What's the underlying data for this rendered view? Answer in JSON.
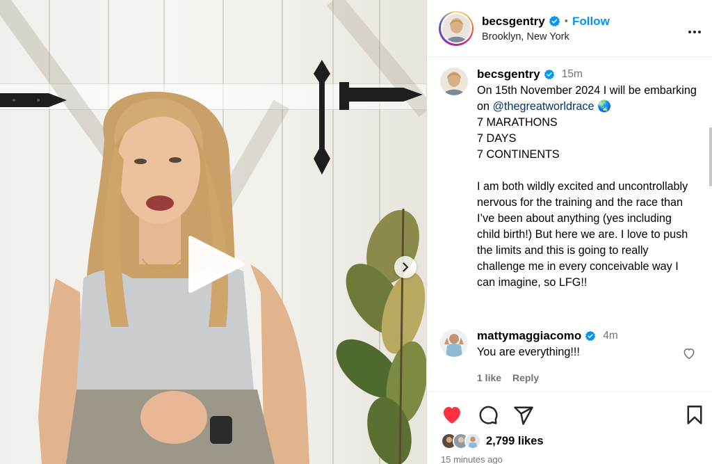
{
  "post": {
    "author": "becsgentry",
    "location": "Brooklyn, New York",
    "follow_label": "Follow",
    "separator": "•"
  },
  "caption": {
    "author": "becsgentry",
    "time": "15m",
    "line1": "On 15th November 2024 I will be embarking on ",
    "mention": "@thegreatworldrace",
    "emoji": "🌏",
    "line2": "7 MARATHONS",
    "line3": "7 DAYS",
    "line4": "7 CONTINENTS",
    "paragraph": "I am both wildly excited and uncontrollably nervous for the training and the race than I’ve been about anything (yes including child birth!) But here we are. I love to push the limits and this is going to really challenge me in every conceivable way I can imagine, so LFG!!"
  },
  "comment": {
    "author": "mattymaggiacomo",
    "time": "4m",
    "text": "You are everything!!!",
    "likes": "1 like",
    "reply_label": "Reply"
  },
  "footer": {
    "likes": "2,799 likes",
    "posted": "15 minutes ago"
  },
  "icons": {
    "like": "heart-filled-icon",
    "comment": "comment-bubble-icon",
    "share": "paper-plane-icon",
    "save": "bookmark-icon",
    "more": "more-horizontal-icon",
    "verified": "verified-badge-icon",
    "play": "play-icon",
    "next": "chevron-right-icon"
  },
  "colors": {
    "accent": "#0095f6",
    "like": "#ff3040",
    "verified": "#0095f6",
    "mention": "#00376b",
    "muted": "#737373"
  }
}
